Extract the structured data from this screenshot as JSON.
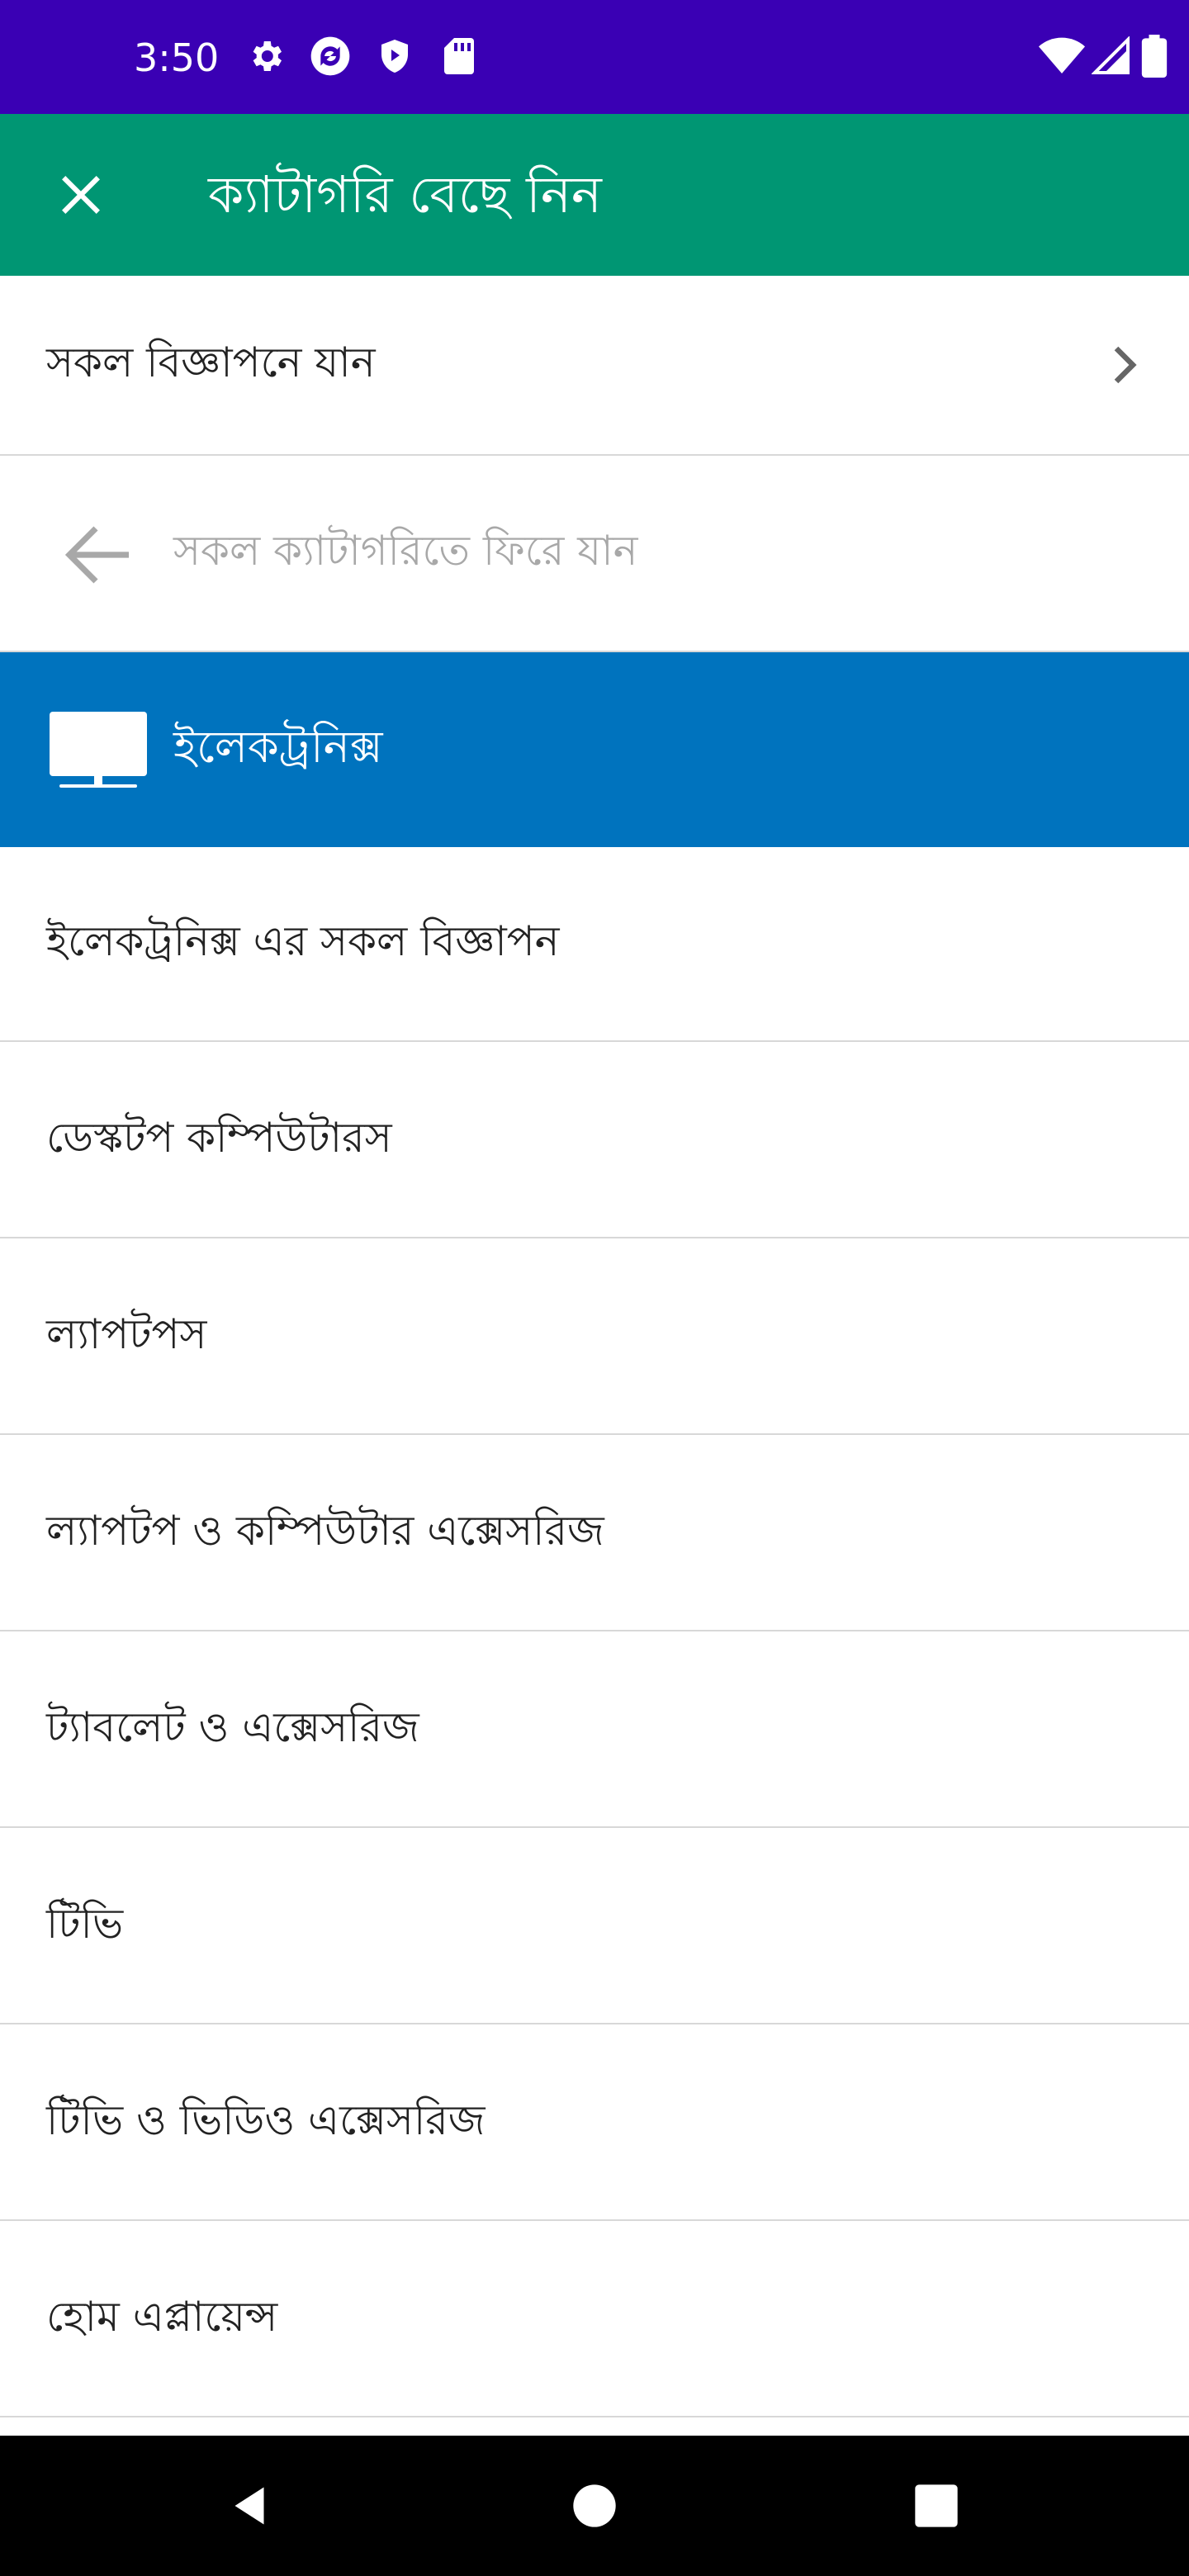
{
  "status_bar": {
    "time": "3:50",
    "left_icons": [
      "gear-icon",
      "sync-icon",
      "shield-play-icon",
      "sd-card-icon"
    ],
    "right_icons": [
      "wifi-icon",
      "signal-icon",
      "battery-icon"
    ],
    "background": "#3a00b4"
  },
  "app_bar": {
    "title": "ক্যাটাগরি বেছে নিন",
    "close_icon": "close-icon",
    "background": "#009673"
  },
  "all_ads_row": {
    "label": "সকল বিজ্ঞাপনে যান",
    "icon": "chevron-right-icon"
  },
  "back_row": {
    "label": "সকল ক্যাটাগরিতে ফিরে যান",
    "icon": "arrow-left-icon"
  },
  "selected_category": {
    "label": "ইলেকট্রনিক্স",
    "icon": "tv-icon",
    "background": "#0073be"
  },
  "subcategories": [
    {
      "label": "ইলেকট্রনিক্স এর সকল বিজ্ঞাপন"
    },
    {
      "label": "ডেস্কটপ কম্পিউটারস"
    },
    {
      "label": "ল্যাপটপস"
    },
    {
      "label": "ল্যাপটপ ও কম্পিউটার এক্সেসরিজ"
    },
    {
      "label": "ট্যাবলেট ও এক্সেসরিজ"
    },
    {
      "label": "টিভি"
    },
    {
      "label": "টিভি ও ভিডিও এক্সেসরিজ"
    },
    {
      "label": "হোম এপ্লায়েন্স"
    }
  ],
  "nav_bar": {
    "icons": [
      "back-triangle-icon",
      "home-circle-icon",
      "recents-square-icon"
    ]
  }
}
